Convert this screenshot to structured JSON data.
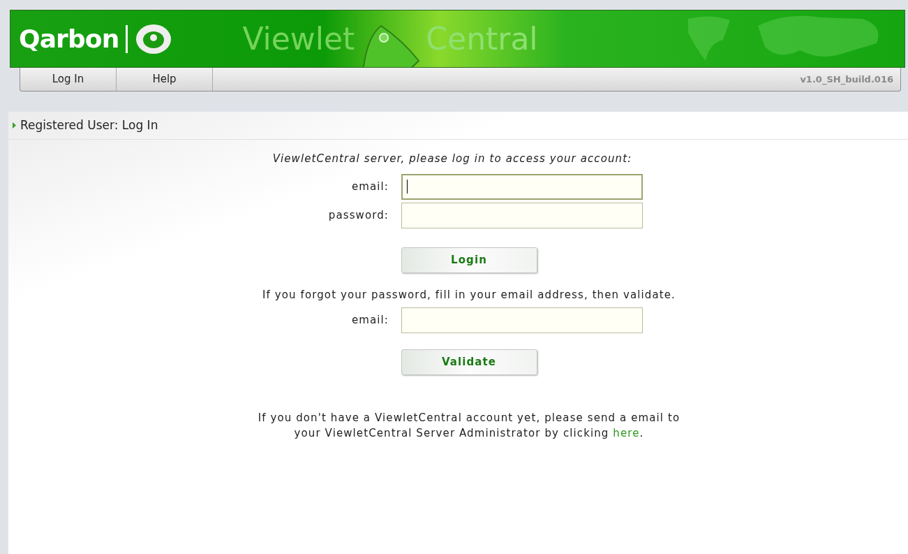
{
  "header": {
    "logo": "Qarbon",
    "title_left": "Viewlet",
    "title_right": "Central"
  },
  "nav": {
    "items": [
      {
        "label": "Log In"
      },
      {
        "label": "Help"
      }
    ],
    "version": "v1.0_SH_build.016"
  },
  "section_title": "Registered User: Log In",
  "login": {
    "intro": "ViewletCentral server, please log in to access your account:",
    "fields": [
      {
        "label": "email:",
        "focused": true
      },
      {
        "label": "password:",
        "focused": false
      }
    ],
    "button": "Login"
  },
  "recover": {
    "intro": "If you forgot your password, fill in your email address, then validate.",
    "fields": [
      {
        "label": "email:",
        "focused": false
      }
    ],
    "button": "Validate"
  },
  "signup": {
    "before": "If you don't have a ViewletCentral account yet, please send a email to your ViewletCentral Server Administrator by clicking ",
    "link": "here",
    "after": "."
  }
}
